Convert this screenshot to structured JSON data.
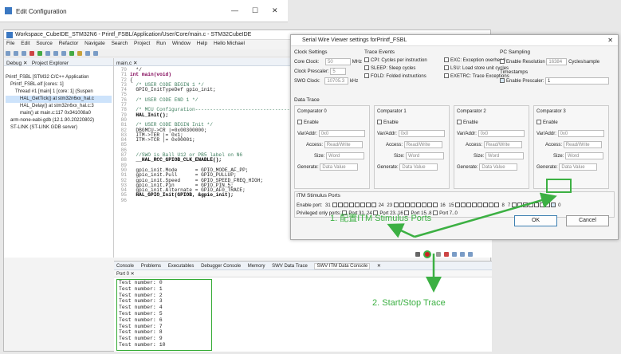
{
  "edit_config": {
    "title": "Edit Configuration",
    "min": "—",
    "max": "☐",
    "close": "✕"
  },
  "ide": {
    "title": "Workspace_CubeIDE_STM32N6 - Printf_FSBL/Application/User/Core/main.c - STM32CubeIDE",
    "menu": [
      "File",
      "Edit",
      "Source",
      "Refactor",
      "Navigate",
      "Search",
      "Project",
      "Run",
      "Window",
      "Help",
      "Hello Michael"
    ],
    "left_tabs": [
      "Debug",
      "Project Explorer"
    ],
    "tree": [
      "Printf_FSBL [STM32 C/C++ Application",
      "Printf_FSBL.elf [cores: 1]",
      "Thread #1 [main] 1 [core: 1] (Suspen",
      "HAL_GetTick() at stm32n6xx_hal.c",
      "HAL_Delay() at stm32n6xx_hal.c:3",
      "main() at main.c:117 0x341008a0",
      "arm-none-eabi-gdb (12.1.90.20220802)",
      "ST-LINK (ST-LINK GDB server)"
    ],
    "editor_tab": "main.c",
    "code": [
      {
        "n": "70",
        "t": "  */"
      },
      {
        "n": "71",
        "t": "int main(void)"
      },
      {
        "n": "72",
        "t": "{"
      },
      {
        "n": "73",
        "t": "  /* USER CODE BEGIN 1 */"
      },
      {
        "n": "74",
        "t": "  GPIO_InitTypeDef gpio_init;"
      },
      {
        "n": "75",
        "t": ""
      },
      {
        "n": "76",
        "t": "  /* USER CODE END 1 */"
      },
      {
        "n": "77",
        "t": ""
      },
      {
        "n": "78",
        "t": "  /* MCU Configuration--------------------------------------------------------*/"
      },
      {
        "n": "79",
        "t": "  HAL_Init();"
      },
      {
        "n": "80",
        "t": ""
      },
      {
        "n": "81",
        "t": "  /* USER CODE BEGIN Init */"
      },
      {
        "n": "82",
        "t": "  DBGMCU->CR |=0x00300000;"
      },
      {
        "n": "83",
        "t": "  ITM->TER |= 0x1;"
      },
      {
        "n": "84",
        "t": "  ITM->TCR |= 0x00001;"
      },
      {
        "n": "85",
        "t": ""
      },
      {
        "n": "86",
        "t": ""
      },
      {
        "n": "87",
        "t": "  //SWO is Ball U12 or PB5 label on N6"
      },
      {
        "n": "88",
        "t": "  __HAL_RCC_GPIOB_CLK_ENABLE();"
      },
      {
        "n": "89",
        "t": ""
      },
      {
        "n": "90",
        "t": "  gpio_init.Mode      = GPIO_MODE_AF_PP;"
      },
      {
        "n": "91",
        "t": "  gpio_init.Pull      = GPIO_PULLUP;"
      },
      {
        "n": "92",
        "t": "  gpio_init.Speed     = GPIO_SPEED_FREQ_HIGH;"
      },
      {
        "n": "93",
        "t": "  gpio_init.Pin       = GPIO_PIN_5;"
      },
      {
        "n": "94",
        "t": "  gpio_init.Alternate = GPIO_AF0_TRACE;"
      },
      {
        "n": "95",
        "t": "  HAL_GPIO_Init(GPIOB, &gpio_init);"
      },
      {
        "n": "96",
        "t": ""
      }
    ],
    "console_tabs": [
      "Console",
      "Problems",
      "Executables",
      "Debugger Console",
      "Memory",
      "SWV Data Trace",
      "SWV ITM Data Console"
    ],
    "port_tab": "Port 0",
    "output": [
      "Test number: 0",
      "Test number: 1",
      "Test number: 2",
      "Test number: 3",
      "Test number: 4",
      "Test number: 5",
      "Test number: 6",
      "Test number: 7",
      "Test number: 8",
      "Test number: 9",
      "Test number: 10"
    ]
  },
  "swv": {
    "title": "Serial Wire Viewer settings forPrintf_FSBL",
    "clock_settings": "Clock Settings",
    "core_clock_label": "Core Clock:",
    "core_clock_value": "50",
    "core_clock_unit": "MHz",
    "prescaler_label": "Clock Prescaler:",
    "prescaler_value": "5",
    "swo_label": "SWO Clock:",
    "swo_value": "10705.3",
    "swo_unit": "kHz",
    "trace_events": "Trace Events",
    "events": [
      "CPI: Cycles per instruction",
      "EXC: Exception overhead",
      "SLEEP: Sleep cycles",
      "LSU: Load store unit cycles",
      "FOLD: Folded instructions",
      "EXETRC: Trace Exceptions"
    ],
    "pc_sampling": "PC Sampling",
    "pc_enable": "Enable",
    "resolution_label": "Resolution",
    "resolution_value": "16384",
    "cycles_label": "Cycles/sample",
    "timestamps": "Timestamps",
    "ts_enable": "Enable",
    "ts_prescaler_label": "Prescaler:",
    "ts_prescaler_value": "1",
    "data_trace": "Data Trace",
    "comparators": [
      "Comparator 0",
      "Comparator 1",
      "Comparator 2",
      "Comparator 3"
    ],
    "comp_enable": "Enable",
    "var_label": "Var/Addr:",
    "var_value": "0x0",
    "access_label": "Access:",
    "access_value": "Read/Write",
    "size_label": "Size:",
    "size_value": "Word",
    "generate_label": "Generate:",
    "generate_value": "Data Value",
    "itm": "ITM Stimulus Ports",
    "enable_port": "Enable port:",
    "port_nums": [
      "31",
      "24",
      "23",
      "16",
      "15",
      "8",
      "7",
      "0"
    ],
    "privileged": "Privileged only ports:",
    "priv_ranges": [
      "Port 31..24",
      "Port 23..16",
      "Port 15..8",
      "Port 7..0"
    ],
    "ok": "OK",
    "cancel": "Cancel"
  },
  "annotations": {
    "step1": "1. 配置ITM Stimulus Ports",
    "step2": "2. Start/Stop Trace"
  },
  "colors": {
    "annotation": "#3cb043"
  }
}
